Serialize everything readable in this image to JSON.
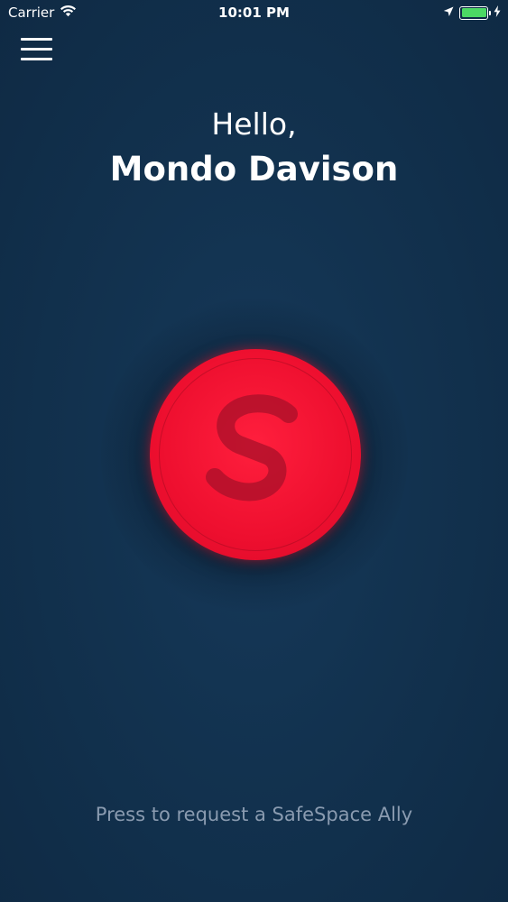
{
  "status_bar": {
    "carrier": "Carrier",
    "time": "10:01 PM",
    "battery_level": 1.0,
    "icons": [
      "wifi-icon",
      "location-arrow-icon",
      "battery-icon",
      "charging-bolt-icon"
    ]
  },
  "header": {
    "menu_icon": "hamburger-menu-icon"
  },
  "greeting": {
    "hello": "Hello,",
    "name": "Mondo Davison"
  },
  "request_button": {
    "logo": "safespace-s-logo",
    "color": "#ee0f2f"
  },
  "hint": {
    "text": "Press to request a SafeSpace Ally"
  },
  "colors": {
    "background": "#12324f",
    "accent": "#ee0f2f",
    "hint_text": "#8a9bb0",
    "battery": "#4cd964"
  }
}
